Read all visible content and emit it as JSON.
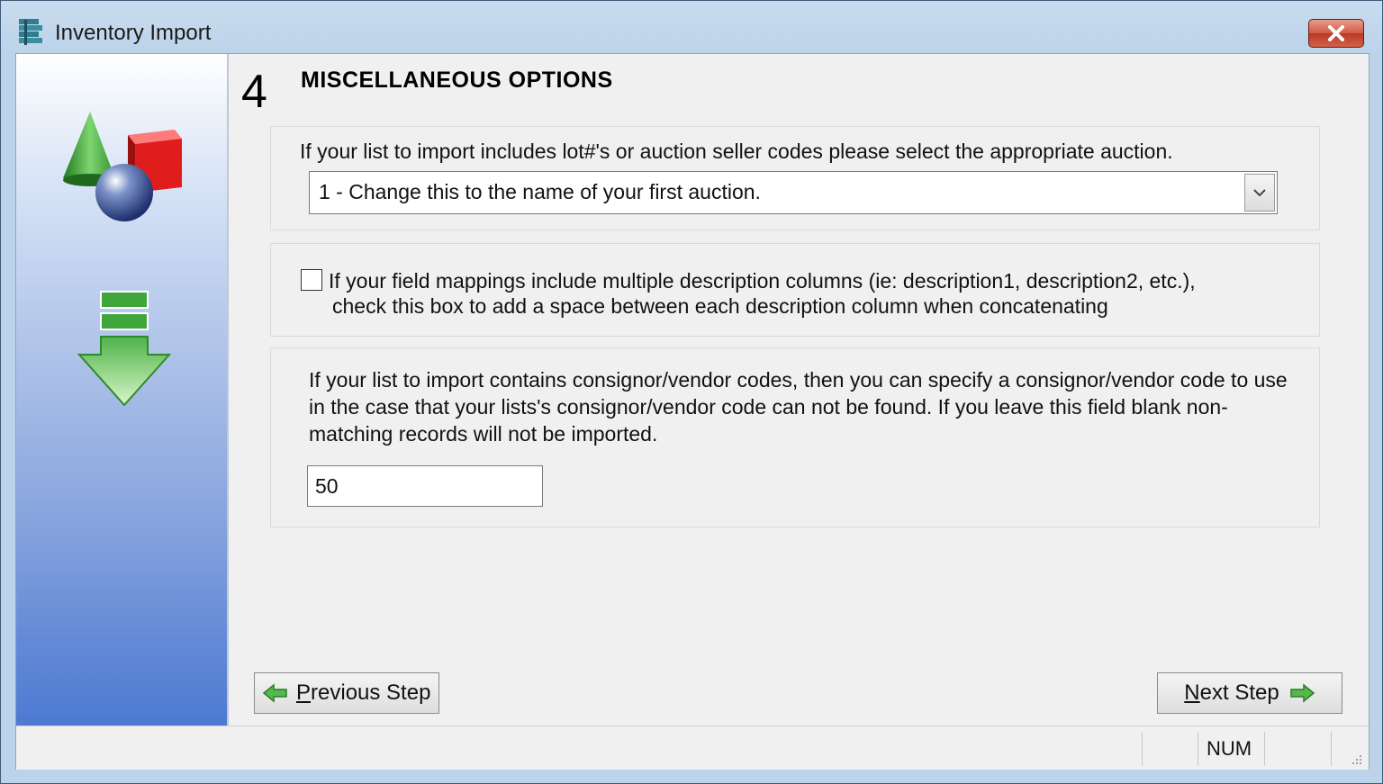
{
  "window": {
    "title": "Inventory Import",
    "close_icon": "close-icon",
    "app_icon": "inventory-app-icon"
  },
  "sidebar": {
    "icons": [
      "shapes-icon",
      "import-arrow-icon"
    ]
  },
  "step": {
    "number": "4",
    "title": "MISCELLANEOUS OPTIONS"
  },
  "auction_panel": {
    "label": "If your list to import includes lot#'s or auction seller codes please select the appropriate auction.",
    "selected_value": "1 - Change this to the name of your first auction."
  },
  "description_panel": {
    "checked": false,
    "line1": "If your field mappings include multiple description columns (ie: description1, description2, etc.),",
    "line2": "check this box to add a space between each description column when concatenating"
  },
  "consignor_panel": {
    "text": "If your list to import contains consignor/vendor codes, then you can specify a consignor/vendor code to use in the case that your lists's consignor/vendor code can not be found. If you leave this field blank non-matching records will not be imported.",
    "value": "50"
  },
  "buttons": {
    "prev_first": "P",
    "prev_rest": "revious Step",
    "next_first": "N",
    "next_rest": "ext Step"
  },
  "statusbar": {
    "num": "NUM"
  },
  "colors": {
    "accent_blue": "#4c79d2",
    "arrow_green": "#3ea63a",
    "close_red": "#c94a33"
  }
}
